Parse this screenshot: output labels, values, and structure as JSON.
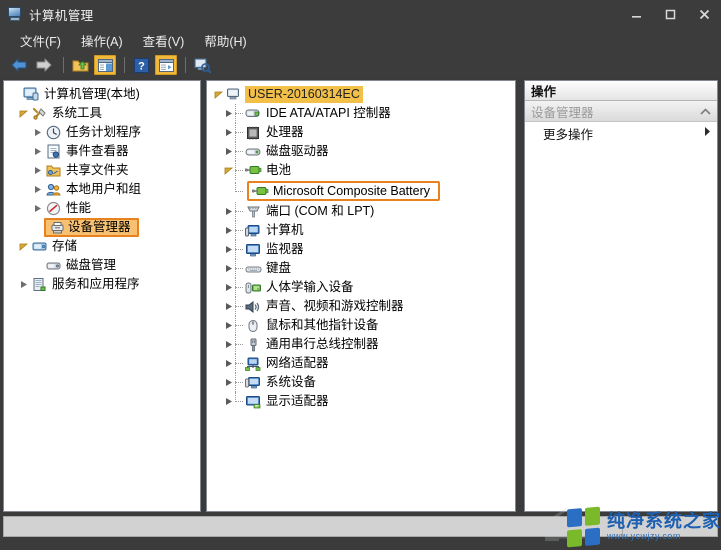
{
  "window": {
    "title": "计算机管理",
    "title_icon": "computer-management-icon",
    "buttons": {
      "minimize": "minimize-icon",
      "maximize": "maximize-icon",
      "close": "close-icon"
    }
  },
  "menubar": {
    "items": [
      {
        "label": "文件(F)",
        "name": "menu-file"
      },
      {
        "label": "操作(A)",
        "name": "menu-action"
      },
      {
        "label": "查看(V)",
        "name": "menu-view"
      },
      {
        "label": "帮助(H)",
        "name": "menu-help"
      }
    ]
  },
  "toolbar": {
    "items": [
      {
        "name": "back-icon",
        "title": "后退"
      },
      {
        "name": "forward-icon",
        "title": "前进"
      },
      {
        "name": "up-folder-icon",
        "title": "向上一级"
      },
      {
        "name": "show-tree-icon",
        "title": "显示/隐藏控制台树"
      },
      {
        "name": "help-icon",
        "title": "帮助"
      },
      {
        "name": "properties-icon",
        "title": "属性"
      },
      {
        "name": "scan-hardware-icon",
        "title": "扫描检测硬件改动"
      }
    ]
  },
  "console_tree": {
    "root": {
      "label": "计算机管理(本地)",
      "icon": "computer-icon"
    },
    "items": [
      {
        "label": "系统工具",
        "icon": "system-tools-icon",
        "indent": 1,
        "twisty": "expanded",
        "highlight": "none"
      },
      {
        "label": "任务计划程序",
        "icon": "clock-icon",
        "indent": 2,
        "twisty": "collapsed",
        "highlight": "none"
      },
      {
        "label": "事件查看器",
        "icon": "event-viewer-icon",
        "indent": 2,
        "twisty": "collapsed",
        "highlight": "none"
      },
      {
        "label": "共享文件夹",
        "icon": "shared-folder-icon",
        "indent": 2,
        "twisty": "collapsed",
        "highlight": "none"
      },
      {
        "label": "本地用户和组",
        "icon": "users-icon",
        "indent": 2,
        "twisty": "collapsed",
        "highlight": "none"
      },
      {
        "label": "性能",
        "icon": "performance-icon",
        "indent": 2,
        "twisty": "collapsed",
        "highlight": "none"
      },
      {
        "label": "设备管理器",
        "icon": "device-manager-icon",
        "indent": 2,
        "twisty": "none",
        "highlight": "box"
      },
      {
        "label": "存储",
        "icon": "storage-icon",
        "indent": 1,
        "twisty": "expanded",
        "highlight": "none"
      },
      {
        "label": "磁盘管理",
        "icon": "disk-management-icon",
        "indent": 2,
        "twisty": "none",
        "highlight": "none"
      },
      {
        "label": "服务和应用程序",
        "icon": "services-icon",
        "indent": 1,
        "twisty": "collapsed",
        "highlight": "none"
      }
    ]
  },
  "device_tree": {
    "root": {
      "label": "USER-20160314EC",
      "icon": "computer-node-icon",
      "twisty": "expanded",
      "highlight": "solid"
    },
    "items": [
      {
        "label": "IDE ATA/ATAPI 控制器",
        "icon": "ide-controller-icon",
        "indent": 1,
        "twisty": "collapsed",
        "highlight": "none"
      },
      {
        "label": "处理器",
        "icon": "processor-icon",
        "indent": 1,
        "twisty": "collapsed",
        "highlight": "none"
      },
      {
        "label": "磁盘驱动器",
        "icon": "disk-drive-icon",
        "indent": 1,
        "twisty": "collapsed",
        "highlight": "none"
      },
      {
        "label": "电池",
        "icon": "battery-icon",
        "indent": 1,
        "twisty": "expanded",
        "highlight": "none"
      },
      {
        "label": "Microsoft Composite Battery",
        "icon": "battery-icon",
        "indent": 2,
        "twisty": "none",
        "highlight": "outline"
      },
      {
        "label": "端口 (COM 和 LPT)",
        "icon": "port-icon",
        "indent": 1,
        "twisty": "collapsed",
        "highlight": "none"
      },
      {
        "label": "计算机",
        "icon": "computer-device-icon",
        "indent": 1,
        "twisty": "collapsed",
        "highlight": "none"
      },
      {
        "label": "监视器",
        "icon": "monitor-icon",
        "indent": 1,
        "twisty": "collapsed",
        "highlight": "none"
      },
      {
        "label": "键盘",
        "icon": "keyboard-icon",
        "indent": 1,
        "twisty": "collapsed",
        "highlight": "none"
      },
      {
        "label": "人体学输入设备",
        "icon": "hid-icon",
        "indent": 1,
        "twisty": "collapsed",
        "highlight": "none"
      },
      {
        "label": "声音、视频和游戏控制器",
        "icon": "sound-icon",
        "indent": 1,
        "twisty": "collapsed",
        "highlight": "none"
      },
      {
        "label": "鼠标和其他指针设备",
        "icon": "mouse-icon",
        "indent": 1,
        "twisty": "collapsed",
        "highlight": "none"
      },
      {
        "label": "通用串行总线控制器",
        "icon": "usb-icon",
        "indent": 1,
        "twisty": "collapsed",
        "highlight": "none"
      },
      {
        "label": "网络适配器",
        "icon": "network-adapter-icon",
        "indent": 1,
        "twisty": "collapsed",
        "highlight": "none"
      },
      {
        "label": "系统设备",
        "icon": "system-device-icon",
        "indent": 1,
        "twisty": "collapsed",
        "highlight": "none"
      },
      {
        "label": "显示适配器",
        "icon": "display-adapter-icon",
        "indent": 1,
        "twisty": "collapsed",
        "highlight": "none"
      }
    ]
  },
  "actions_pane": {
    "header": "操作",
    "section_title": "设备管理器",
    "collapse_icon": "chevron-up-icon",
    "items": [
      {
        "label": "更多操作",
        "submenu_icon": "chevron-right-icon"
      }
    ]
  },
  "statusbar": {
    "text": ""
  },
  "watermark": {
    "title": "纯净系统之家",
    "url": "www.ycwjzy.com",
    "logo_colors": [
      "#2b6fc4",
      "#7ab929",
      "#7ab929",
      "#2b6fc4"
    ]
  },
  "colors": {
    "titlebar_bg": "#3c3c3c",
    "selection_solid": "#f2c048",
    "highlight_border": "#e8821e",
    "highlight_fill": "#f7c171",
    "pane_border": "#828790",
    "watermark_blue": "#1d5fb0"
  }
}
